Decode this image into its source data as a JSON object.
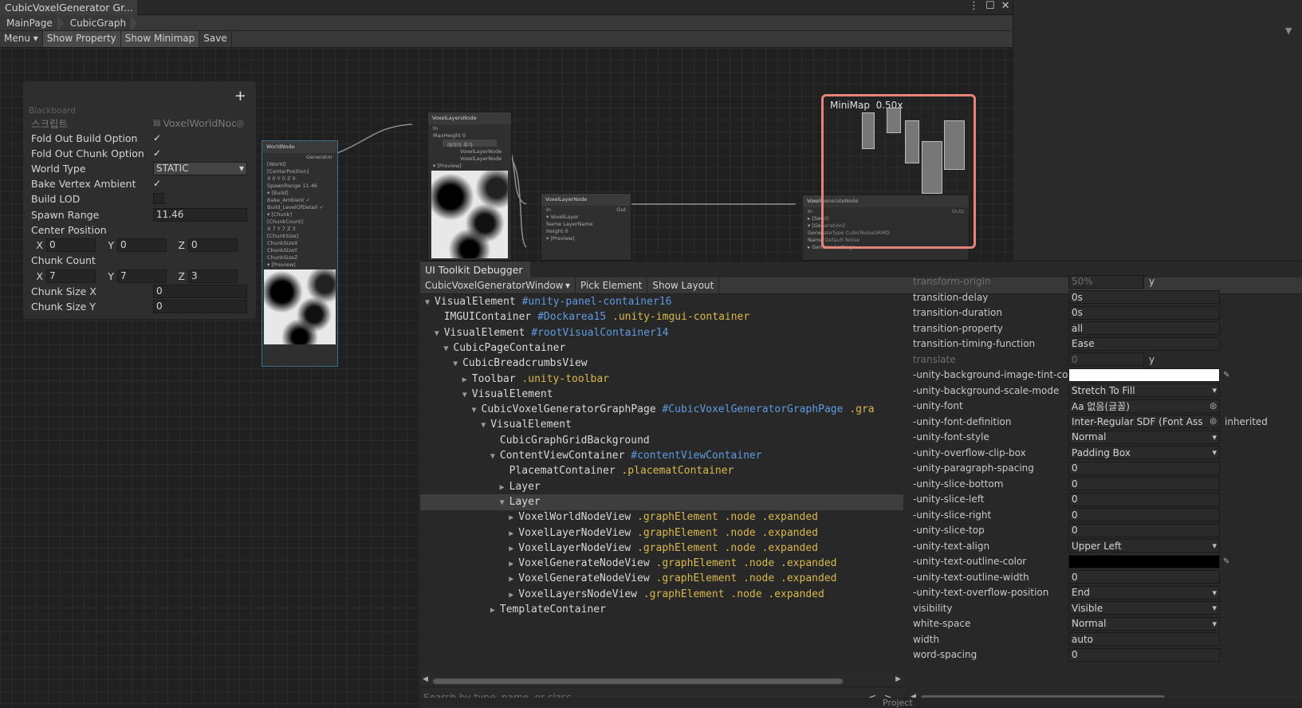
{
  "window": {
    "title": "CubicVoxelGenerator Gr...",
    "controls": [
      "⋮",
      "☐",
      "✕"
    ]
  },
  "breadcrumbs": [
    "MainPage",
    "CubicGraph"
  ],
  "toolbar": {
    "menu": "Menu",
    "show_property": "Show Property",
    "show_minimap": "Show Minimap",
    "save": "Save"
  },
  "blackboard": {
    "title": "Blackboard",
    "add": "+",
    "script_label": "스크립트",
    "script_value": "VoxelWorldNod",
    "fold_out_build": "Fold Out Build Option",
    "fold_out_chunk": "Fold Out Chunk Option",
    "world_type_label": "World Type",
    "world_type_value": "STATIC",
    "bake_vertex": "Bake Vertex Ambient",
    "build_lod": "Build LOD",
    "spawn_range_label": "Spawn Range",
    "spawn_range_value": "11.46",
    "center_position": "Center Position",
    "center": {
      "x": "0",
      "y": "0",
      "z": "0"
    },
    "chunk_count": "Chunk Count",
    "chunk": {
      "x": "7",
      "y": "7",
      "z": "3"
    },
    "chunk_size_x_label": "Chunk Size X",
    "chunk_size_x_value": "0",
    "chunk_size_y_label": "Chunk Size Y",
    "chunk_size_y_value": "0",
    "axis_x": "X",
    "axis_y": "Y",
    "axis_z": "Z"
  },
  "nodes": {
    "world_node": {
      "title": "WorldNode",
      "port": "Generator",
      "rows": [
        "[World]",
        "[CenterPosition]",
        "X 0   Y 0   Z 0",
        "SpawnRange  11.46",
        "▾ [Build]",
        "Bake_Ambient ✓",
        "Build_LevelOfDetail ✓",
        "▾ [Chunk]",
        "[ChunkCount]",
        "X 7   Y 7   Z 3",
        "[ChunkSize]",
        "ChunkSizeX",
        "ChunkSizeY",
        "ChunkSizeZ",
        "▾ [Preview]"
      ]
    },
    "layers_node": {
      "title": "VoxelLayersNode",
      "in": "In",
      "rows": [
        "MaxHeight   0",
        "레이어 추가",
        "VoxelLayerNode",
        "VoxelLayerNode",
        "▾ [Preview]"
      ]
    },
    "layer_node": {
      "title": "VoxelLayerNode",
      "in": "In",
      "out": "Out",
      "rows": [
        "▾ VoxelLayer",
        "Name   LayerName",
        "Height   0",
        "▾ [Preview]"
      ]
    },
    "generate_node": {
      "title": "VoxelGenerateNode",
      "in": "In",
      "out": "Outs",
      "rows": [
        "▸ [Seed]",
        "▾ [Generation]",
        "GenerateType  CubicNoiseSRMD",
        "Name   Default Noise",
        "▸ General Settings"
      ]
    }
  },
  "minimap": {
    "label": "MiniMap",
    "zoom": "0.50x"
  },
  "debugger": {
    "tab": "UI Toolkit Debugger",
    "panel": "CubicVoxelGeneratorWindow",
    "pick": "Pick Element",
    "show_layout": "Show Layout",
    "search_placeholder": "Search by type, name, or class",
    "nav_prev": "<",
    "nav_next": ">",
    "tree": [
      {
        "indent": 0,
        "tri": "▼",
        "type": "VisualElement",
        "id": "#unity-panel-container16",
        "cls": ""
      },
      {
        "indent": 1,
        "tri": "",
        "type": "IMGUIContainer",
        "id": "#Dockarea15",
        "cls": ".unity-imgui-container"
      },
      {
        "indent": 1,
        "tri": "▼",
        "type": "VisualElement",
        "id": "#rootVisualContainer14",
        "cls": ""
      },
      {
        "indent": 2,
        "tri": "▼",
        "type": "CubicPageContainer",
        "id": "",
        "cls": ""
      },
      {
        "indent": 3,
        "tri": "▼",
        "type": "CubicBreadcrumbsView",
        "id": "",
        "cls": ""
      },
      {
        "indent": 4,
        "tri": "▶",
        "type": "Toolbar",
        "id": "",
        "cls": ".unity-toolbar"
      },
      {
        "indent": 4,
        "tri": "▼",
        "type": "VisualElement",
        "id": "",
        "cls": ""
      },
      {
        "indent": 5,
        "tri": "▼",
        "type": "CubicVoxelGeneratorGraphPage",
        "id": "#CubicVoxelGeneratorGraphPage",
        "cls": ".gra"
      },
      {
        "indent": 6,
        "tri": "▼",
        "type": "VisualElement",
        "id": "",
        "cls": ""
      },
      {
        "indent": 7,
        "tri": "",
        "type": "CubicGraphGridBackground",
        "id": "",
        "cls": ""
      },
      {
        "indent": 7,
        "tri": "▼",
        "type": "ContentViewContainer",
        "id": "#contentViewContainer",
        "cls": ""
      },
      {
        "indent": 8,
        "tri": "",
        "type": "PlacematContainer",
        "id": "",
        "cls": ".placematContainer"
      },
      {
        "indent": 8,
        "tri": "▶",
        "type": "Layer",
        "id": "",
        "cls": ""
      },
      {
        "indent": 8,
        "tri": "▼",
        "type": "Layer",
        "id": "",
        "cls": "",
        "selected": true
      },
      {
        "indent": 9,
        "tri": "▶",
        "type": "VoxelWorldNodeView",
        "id": "",
        "cls": ".graphElement .node .expanded"
      },
      {
        "indent": 9,
        "tri": "▶",
        "type": "VoxelLayerNodeView",
        "id": "",
        "cls": ".graphElement .node .expanded"
      },
      {
        "indent": 9,
        "tri": "▶",
        "type": "VoxelLayerNodeView",
        "id": "",
        "cls": ".graphElement .node .expanded"
      },
      {
        "indent": 9,
        "tri": "▶",
        "type": "VoxelGenerateNodeView",
        "id": "",
        "cls": ".graphElement .node .expanded"
      },
      {
        "indent": 9,
        "tri": "▶",
        "type": "VoxelGenerateNodeView",
        "id": "",
        "cls": ".graphElement .node .expanded"
      },
      {
        "indent": 9,
        "tri": "▶",
        "type": "VoxelLayersNodeView",
        "id": "",
        "cls": ".graphElement .node .expanded"
      },
      {
        "indent": 7,
        "tri": "▶",
        "type": "TemplateContainer",
        "id": "",
        "cls": ""
      }
    ],
    "props": [
      {
        "name": "transform-origin",
        "value": "50%",
        "extra": "y",
        "disabled": true
      },
      {
        "name": "transition-delay",
        "value": "0s"
      },
      {
        "name": "transition-duration",
        "value": "0s"
      },
      {
        "name": "transition-property",
        "value": "all"
      },
      {
        "name": "transition-timing-function",
        "value": "Ease"
      },
      {
        "name": "translate",
        "value": "0",
        "extra": "y",
        "disabled": true
      },
      {
        "name": "-unity-background-image-tint-color",
        "value": "",
        "swatch": "white"
      },
      {
        "name": "-unity-background-scale-mode",
        "value": "Stretch To Fill",
        "dropdown": true
      },
      {
        "name": "-unity-font",
        "value": "Aa 없음(글꼴)",
        "target": true
      },
      {
        "name": "-unity-font-definition",
        "value": "Inter-Regular SDF (Font Ass",
        "target": true,
        "note": "inherited"
      },
      {
        "name": "-unity-font-style",
        "value": "Normal",
        "dropdown": true
      },
      {
        "name": "-unity-overflow-clip-box",
        "value": "Padding Box",
        "dropdown": true
      },
      {
        "name": "-unity-paragraph-spacing",
        "value": "0"
      },
      {
        "name": "-unity-slice-bottom",
        "value": "0"
      },
      {
        "name": "-unity-slice-left",
        "value": "0"
      },
      {
        "name": "-unity-slice-right",
        "value": "0"
      },
      {
        "name": "-unity-slice-top",
        "value": "0"
      },
      {
        "name": "-unity-text-align",
        "value": "Upper Left",
        "dropdown": true
      },
      {
        "name": "-unity-text-outline-color",
        "value": "",
        "swatch": "black"
      },
      {
        "name": "-unity-text-outline-width",
        "value": "0"
      },
      {
        "name": "-unity-text-overflow-position",
        "value": "End",
        "dropdown": true
      },
      {
        "name": "visibility",
        "value": "Visible",
        "dropdown": true
      },
      {
        "name": "white-space",
        "value": "Normal",
        "dropdown": true
      },
      {
        "name": "width",
        "value": "auto"
      },
      {
        "name": "word-spacing",
        "value": "0"
      }
    ],
    "bottom_label": "Project"
  }
}
